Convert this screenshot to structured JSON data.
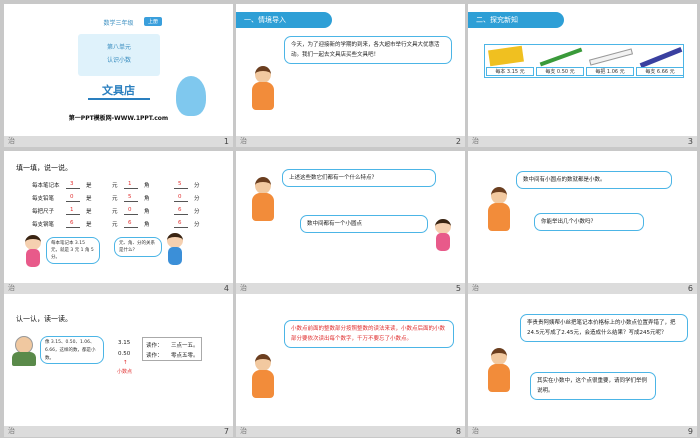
{
  "colors": {
    "accent": "#2e9fd6",
    "bubble_border": "#4cb5e6",
    "red_text": "#e03030",
    "footer": "#dcdcdc"
  },
  "slides": [
    {
      "number": "1",
      "grade": "数学三年级",
      "badge": "上册",
      "unit": "第八单元",
      "topic": "认识小数",
      "title": "文具店",
      "watermark": "第一PPT模板网-WWW.1PPT.com"
    },
    {
      "number": "2",
      "section": "一、情境导入",
      "bubble": "今天，为了迎接新的学期的到来，各大超市举行文具大优惠活动。我们一起去文具店买些文具吧！"
    },
    {
      "number": "3",
      "section": "二、探究新知",
      "prices": [
        "每本 3.15 元",
        "每支 0.50 元",
        "每把 1.06 元",
        "每支 6.66 元"
      ]
    },
    {
      "number": "4",
      "heading": "填一填，说一说。",
      "rows": [
        {
          "item": "每本笔记本",
          "yuan": "3",
          "jiao": "1",
          "fen": "5"
        },
        {
          "item": "每支铅笔",
          "yuan": "0",
          "jiao": "5",
          "fen": "0"
        },
        {
          "item": "每把尺子",
          "yuan": "1",
          "jiao": "0",
          "fen": "6"
        },
        {
          "item": "每支钢笔",
          "yuan": "6",
          "jiao": "6",
          "fen": "6"
        }
      ],
      "labels": {
        "shi": "是",
        "yuan": "元",
        "jiao": "角",
        "fen": "分"
      },
      "kid_left_bubble": "每本笔记本 3.15 元，就是 3 元 1 角 5 分。",
      "kid_right_bubble": "元、角、分的关系是什么？"
    },
    {
      "number": "5",
      "bubble_top": "上述这些数它们都有一个什么特点？",
      "bubble_bottom": "数中间都有一个小圆点"
    },
    {
      "number": "6",
      "bubble_top": "数中间有小圆点的数就都是小数。",
      "bubble_bottom": "你能举出几个小数吗？"
    },
    {
      "number": "7",
      "heading": "认一认，读一读。",
      "bubble": "像 3.15、0.50、1.06、6.66，这样的数，都是小数。",
      "examples": [
        {
          "num": "3.15",
          "read_label": "读作：",
          "read": "三点一五。"
        },
        {
          "num": "0.50",
          "read_label": "读作：",
          "read": "零点五零。"
        }
      ],
      "arrow": "↑",
      "dot_label": "小数点"
    },
    {
      "number": "8",
      "bubble": "小数点前面的整数部分按照整数的读法来读，小数点后面的小数部分要依次读出每个数字，千万不要忘了小数点。"
    },
    {
      "number": "9",
      "bubble_top": "李贵贵阿姨帮小丝把笔记本价格标上的小数点位置弄错了，把24.5元写成了2.45元，会造成什么结果？写成245元呢？",
      "bubble_bottom": "其实在小数中，这个点很重要，请同学们举例说明。"
    }
  ],
  "footer_mark": "治"
}
